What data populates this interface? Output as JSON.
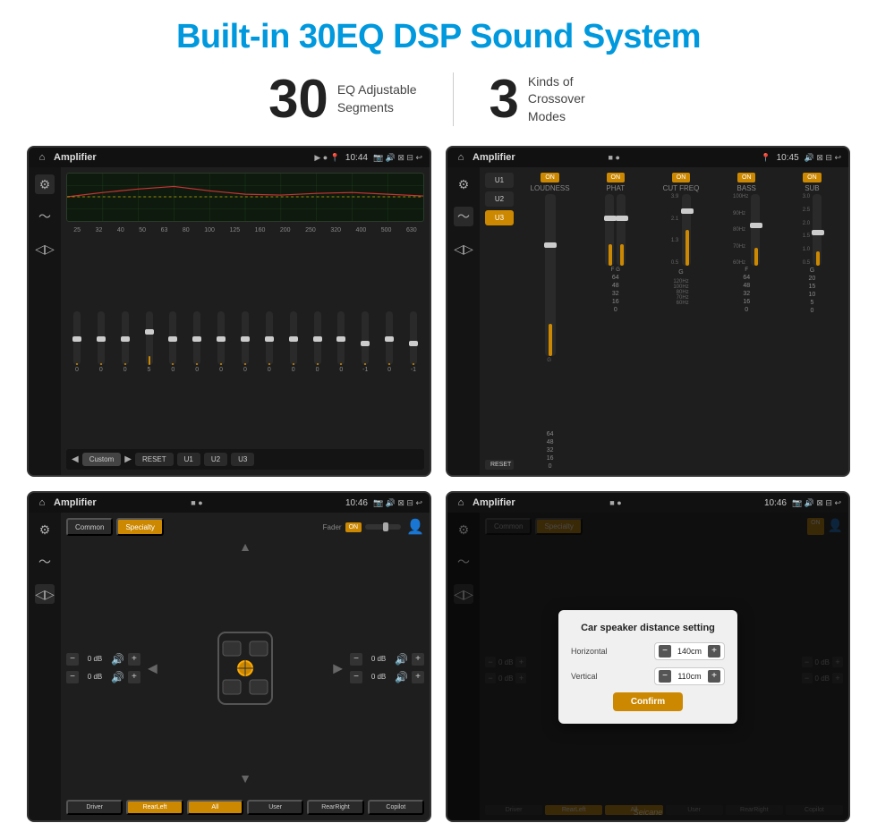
{
  "page": {
    "title": "Built-in 30EQ DSP Sound System",
    "stats": [
      {
        "number": "30",
        "description": "EQ Adjustable\nSegments"
      },
      {
        "number": "3",
        "description": "Kinds of\nCrossover Modes"
      }
    ]
  },
  "screen1": {
    "title": "Amplifier",
    "time": "10:44",
    "eq_freqs": [
      "25",
      "32",
      "40",
      "50",
      "63",
      "80",
      "100",
      "125",
      "160",
      "200",
      "250",
      "320",
      "400",
      "500",
      "630"
    ],
    "eq_values": [
      "0",
      "0",
      "0",
      "5",
      "0",
      "0",
      "0",
      "0",
      "0",
      "0",
      "0",
      "0",
      "-1",
      "0",
      "-1"
    ],
    "eq_preset": "Custom",
    "buttons": [
      "RESET",
      "U1",
      "U2",
      "U3"
    ],
    "ui_preset": "Custom"
  },
  "screen2": {
    "title": "Amplifier",
    "time": "10:45",
    "presets": [
      "U1",
      "U2",
      "U3"
    ],
    "active_preset": "U3",
    "channels": [
      "LOUDNESS",
      "PHAT",
      "CUT FREQ",
      "BASS",
      "SUB"
    ],
    "channel_states": [
      "ON",
      "ON",
      "ON",
      "ON",
      "ON"
    ],
    "freq_labels": [
      "G",
      "F",
      "G",
      "F",
      "G",
      "G"
    ],
    "reset_label": "RESET"
  },
  "screen3": {
    "title": "Amplifier",
    "time": "10:46",
    "preset_buttons": [
      "Common",
      "Specialty"
    ],
    "active_preset": "Specialty",
    "fader_label": "Fader",
    "fader_state": "ON",
    "zones": {
      "left_top": "0 dB",
      "right_top": "0 dB",
      "left_bottom": "0 dB",
      "right_bottom": "0 dB"
    },
    "bottom_buttons": [
      "Driver",
      "RearLeft",
      "All",
      "User",
      "RearRight",
      "Copilot"
    ],
    "active_zone": "All"
  },
  "screen4": {
    "title": "Amplifier",
    "time": "10:46",
    "dialog": {
      "title": "Car speaker distance setting",
      "fields": [
        {
          "label": "Horizontal",
          "value": "140cm"
        },
        {
          "label": "Vertical",
          "value": "110cm"
        }
      ],
      "confirm_label": "Confirm"
    },
    "preset_buttons": [
      "Common",
      "Specialty"
    ],
    "active_preset": "Specialty",
    "right_values": [
      "0 dB",
      "0 dB"
    ],
    "bottom_buttons": [
      "Driver",
      "RearLeft",
      "All",
      "User",
      "RearRight",
      "Copilot"
    ]
  },
  "watermark": "Seicane"
}
